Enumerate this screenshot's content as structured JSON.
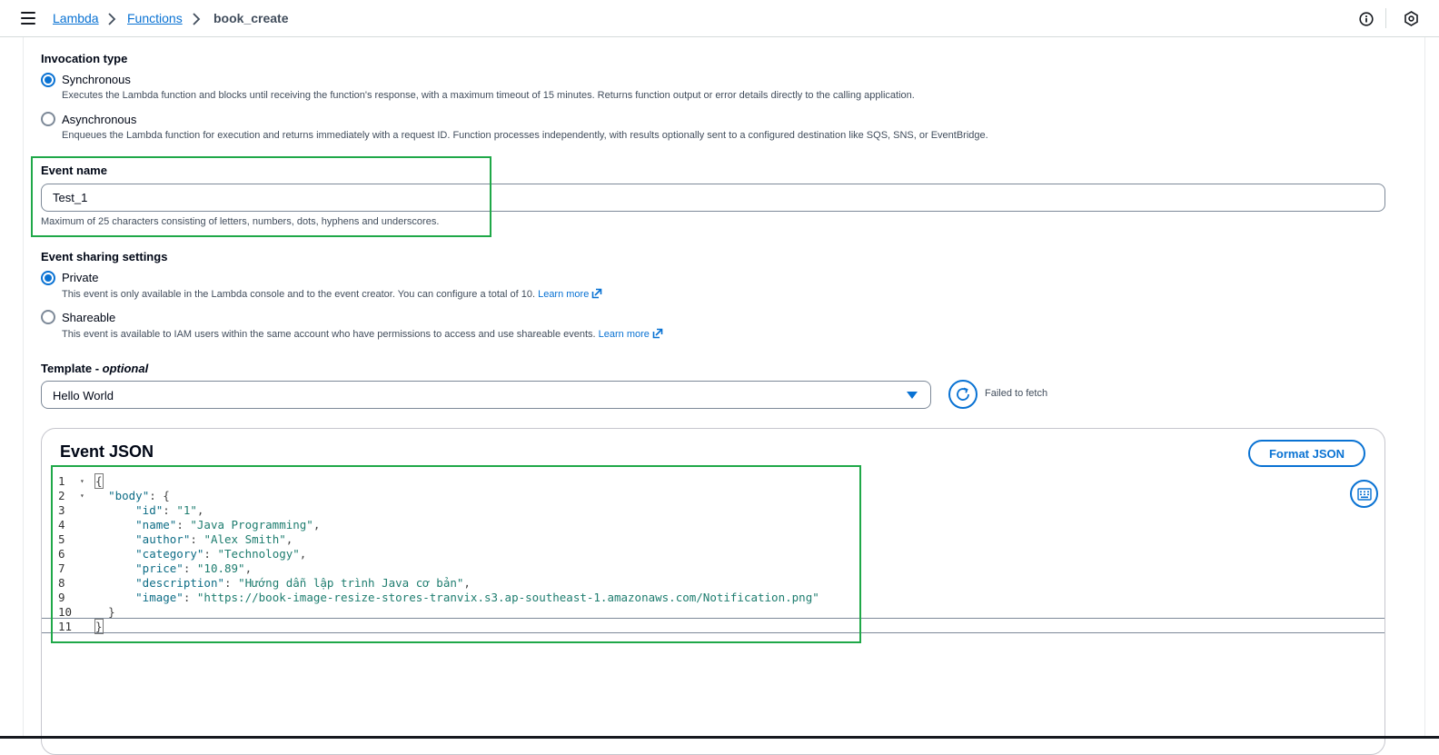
{
  "topbar": {
    "breadcrumb": [
      {
        "label": "Lambda"
      },
      {
        "label": "Functions"
      },
      {
        "label": "book_create"
      }
    ]
  },
  "invocation": {
    "title": "Invocation type",
    "options": [
      {
        "label": "Synchronous",
        "selected": true,
        "description": "Executes the Lambda function and blocks until receiving the function's response, with a maximum timeout of 15 minutes. Returns function output or error details directly to the calling application."
      },
      {
        "label": "Asynchronous",
        "selected": false,
        "description": "Enqueues the Lambda function for execution and returns immediately with a request ID. Function processes independently, with results optionally sent to a configured destination like SQS, SNS, or EventBridge."
      }
    ]
  },
  "event_name": {
    "label": "Event name",
    "value": "Test_1",
    "hint": "Maximum of 25 characters consisting of letters, numbers, dots, hyphens and underscores."
  },
  "sharing": {
    "title": "Event sharing settings",
    "options": [
      {
        "label": "Private",
        "selected": true,
        "description": "This event is only available in the Lambda console and to the event creator. You can configure a total of 10.",
        "link": "Learn more"
      },
      {
        "label": "Shareable",
        "selected": false,
        "description": "This event is available to IAM users within the same account who have permissions to access and use shareable events.",
        "link": "Learn more"
      }
    ]
  },
  "template": {
    "label": "Template - ",
    "label_optional": "optional",
    "selected": "Hello World",
    "status": "Failed to fetch"
  },
  "editor": {
    "title": "Event JSON",
    "format_label": "Format JSON",
    "lines": [
      {
        "n": "1",
        "fold": true,
        "indent": "",
        "key": "",
        "val": "",
        "punct": "{",
        "box": true
      },
      {
        "n": "2",
        "fold": true,
        "indent": "  ",
        "key": "\"body\"",
        "val": "",
        "punct": ": {"
      },
      {
        "n": "3",
        "indent": "      ",
        "key": "\"id\"",
        "val": "\"1\"",
        "punct": ","
      },
      {
        "n": "4",
        "indent": "      ",
        "key": "\"name\"",
        "val": "\"Java Programming\"",
        "punct": ","
      },
      {
        "n": "5",
        "indent": "      ",
        "key": "\"author\"",
        "val": "\"Alex Smith\"",
        "punct": ","
      },
      {
        "n": "6",
        "indent": "      ",
        "key": "\"category\"",
        "val": "\"Technology\"",
        "punct": ","
      },
      {
        "n": "7",
        "indent": "      ",
        "key": "\"price\"",
        "val": "\"10.89\"",
        "punct": ","
      },
      {
        "n": "8",
        "indent": "      ",
        "key": "\"description\"",
        "val": "\"Hướng dẫn lập trình Java cơ bản\"",
        "punct": ","
      },
      {
        "n": "9",
        "indent": "      ",
        "key": "\"image\"",
        "val": "\"https://book-image-resize-stores-tranvix.s3.ap-southeast-1.amazonaws.com/Notification.png\"",
        "punct": ""
      },
      {
        "n": "10",
        "indent": "  ",
        "key": "",
        "val": "",
        "punct": "}"
      },
      {
        "n": "11",
        "indent": "",
        "key": "",
        "val": "",
        "punct": "}",
        "box": true
      }
    ]
  },
  "colors": {
    "accent": "#0972d3",
    "highlight": "#1fa848"
  }
}
